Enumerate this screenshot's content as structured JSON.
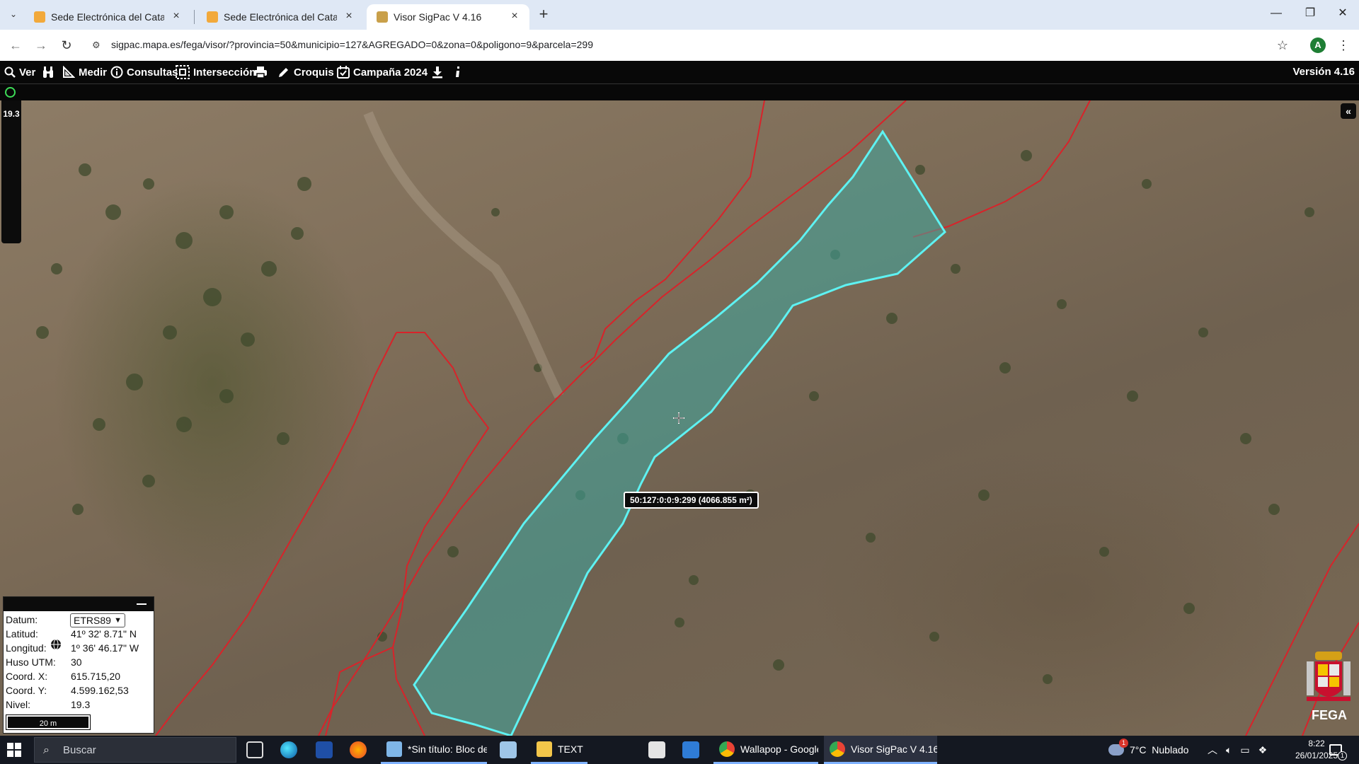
{
  "browser": {
    "tabs": [
      {
        "title": "Sede Electrónica del Catastro -",
        "active": false
      },
      {
        "title": "Sede Electrónica del Catastro",
        "active": false
      },
      {
        "title": "Visor SigPac V 4.16",
        "active": true
      }
    ],
    "url": "sigpac.mapa.es/fega/visor/?provincia=50&municipio=127&AGREGADO=0&zona=0&poligono=9&parcela=299",
    "profile_initial": "A"
  },
  "app": {
    "toolbar": {
      "ver": "Ver",
      "medir": "Medir",
      "consultas": "Consultas",
      "interseccion": "Intersección",
      "croquis": "Croquis",
      "campana": "Campaña 2024",
      "version": "Versión 4.16"
    },
    "zoom_level": "19.3",
    "parcel_tooltip": "50:127:0:0:9:299 (4066.855 m²)",
    "fega_label": "FEGA"
  },
  "info_panel": {
    "datum_label": "Datum:",
    "datum_value": "ETRS89",
    "lat_label": "Latitud:",
    "lat_value": "41º 32' 8.71\" N",
    "lon_label": "Longitud:",
    "lon_value": "1º 36' 46.17\" W",
    "huso_label": "Huso UTM:",
    "huso_value": "30",
    "x_label": "Coord. X:",
    "x_value": "615.715,20",
    "y_label": "Coord. Y:",
    "y_value": "4.599.162,53",
    "nivel_label": "Nivel:",
    "nivel_value": "19.3",
    "scale": "20 m"
  },
  "taskbar": {
    "search_placeholder": "Buscar",
    "apps": [
      {
        "label": "*Sin título: Bloc de ..."
      },
      {
        "label": "TEXT"
      },
      {
        "label": "Wallapop - Google ..."
      },
      {
        "label": "Visor SigPac V 4.16 ..."
      }
    ],
    "weather": "7°C  Nublado",
    "weather_badge": "1",
    "time": "8:22",
    "date": "26/01/2025",
    "notif_count": "1"
  },
  "colors": {
    "parcel_fill": "#3fa8a0",
    "parcel_stroke": "#5ef2f2",
    "boundary": "#d8232a",
    "toolbar_bg": "#080808"
  }
}
